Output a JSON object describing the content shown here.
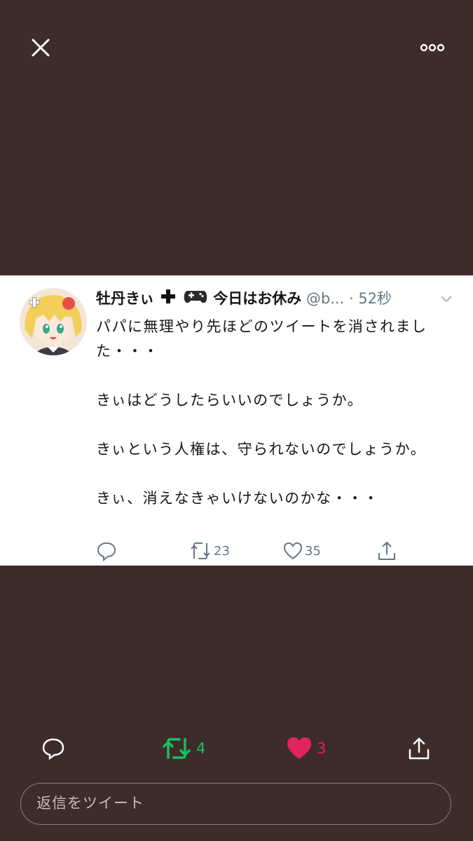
{
  "header": {
    "close_icon": "close-icon",
    "more_icon": "more-dots-icon"
  },
  "tweet": {
    "display_name": "牡丹きぃ",
    "display_name_suffix": "今日はお休み",
    "handle": "@b...",
    "time": "· 52秒",
    "body": [
      "パパに無理やり先ほどのツイートを消されました・・・",
      "きぃはどうしたらいいのでしょうか。",
      "きぃという人権は、守られないのでしょうか。",
      "きぃ、消えなきゃいけないのかな・・・"
    ],
    "retweets": "23",
    "likes": "35"
  },
  "actions": {
    "retweet_count": "4",
    "like_count": "3"
  },
  "reply": {
    "placeholder": "返信をツイート"
  },
  "colors": {
    "background": "#3e2c2b",
    "retweet_green": "#17bf63",
    "like_red": "#e0245e"
  }
}
